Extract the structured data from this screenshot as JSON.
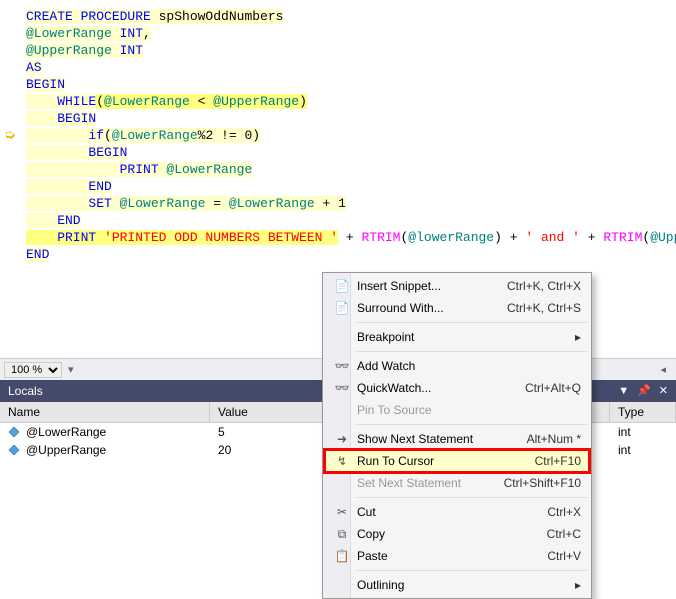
{
  "code": {
    "l1p1": "CREATE PROCEDURE",
    "l1p2": " spShowOddNumbers",
    "l2p1": "@LowerRange",
    "l2p2": " INT",
    "l2p3": ",",
    "l3p1": "@UpperRange",
    "l3p2": " INT",
    "l4": "AS",
    "l5": "BEGIN",
    "l6p1": "    WHILE",
    "l6p2": "(",
    "l6p3": "@LowerRange",
    "l6p4": " < ",
    "l6p5": "@UpperRange",
    "l6p6": ")",
    "l7": "    BEGIN",
    "l8p1": "        if",
    "l8p2": "(",
    "l8p3": "@LowerRange",
    "l8p4": "%2 != 0)",
    "l9": "        BEGIN",
    "l10p1": "            PRINT",
    "l10p2": " @LowerRange",
    "l11": "        END",
    "l12p1": "        SET",
    "l12p2": " @LowerRange",
    "l12p3": " = ",
    "l12p4": "@LowerRange",
    "l12p5": " + 1",
    "l13": "    END",
    "l14p1": "    PRINT",
    "l14p2": " 'PRINTED ODD NUMBERS BETWEEN '",
    "l14p3": " + ",
    "l14p4": "RTRIM",
    "l14p5": "(",
    "l14p6": "@lowerRange",
    "l14p7": ") + ",
    "l14p8": "' and '",
    "l14p9": " + ",
    "l14p10": "RTRIM",
    "l14p11": "(",
    "l14p12": "@UpperRange",
    "l15": "END"
  },
  "zoom": {
    "value": "100 %"
  },
  "panel": {
    "title": "Locals"
  },
  "locals": {
    "cols": {
      "name": "Name",
      "value": "Value",
      "type": "Type"
    },
    "rows": [
      {
        "name": "@LowerRange",
        "value": "5",
        "type": "int"
      },
      {
        "name": "@UpperRange",
        "value": "20",
        "type": "int"
      }
    ]
  },
  "menu": {
    "insert_snippet": "Insert Snippet...",
    "insert_snippet_sc": "Ctrl+K, Ctrl+X",
    "surround_with": "Surround With...",
    "surround_with_sc": "Ctrl+K, Ctrl+S",
    "breakpoint": "Breakpoint",
    "add_watch": "Add Watch",
    "quickwatch": "QuickWatch...",
    "quickwatch_sc": "Ctrl+Alt+Q",
    "pin": "Pin To Source",
    "show_next": "Show Next Statement",
    "show_next_sc": "Alt+Num *",
    "run_to_cursor": "Run To Cursor",
    "run_to_cursor_sc": "Ctrl+F10",
    "set_next": "Set Next Statement",
    "set_next_sc": "Ctrl+Shift+F10",
    "cut": "Cut",
    "cut_sc": "Ctrl+X",
    "copy": "Copy",
    "copy_sc": "Ctrl+C",
    "paste": "Paste",
    "paste_sc": "Ctrl+V",
    "outlining": "Outlining"
  }
}
